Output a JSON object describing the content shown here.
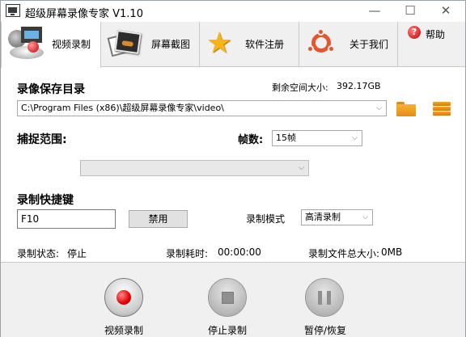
{
  "window": {
    "title": "超级屏幕录像专家 V1.10",
    "min_glyph": "—",
    "max_glyph": "☐",
    "close_glyph": "✕"
  },
  "tabs": [
    {
      "label": "视频录制",
      "icon": "video-record-icon",
      "active": true
    },
    {
      "label": "屏幕截图",
      "icon": "screenshot-icon",
      "active": false
    },
    {
      "label": "软件注册",
      "icon": "star-icon",
      "active": false
    },
    {
      "label": "关于我们",
      "icon": "ubuntu-ring-icon",
      "active": false
    },
    {
      "label": "帮助",
      "icon": "help-icon",
      "active": false
    }
  ],
  "help_icon_glyph": "?",
  "star_glyph": "★",
  "save": {
    "title": "录像保存目录",
    "free_space_label": "剩余空间大小:",
    "free_space_value": "392.17GB",
    "path": "C:\\Program Files (x86)\\超级屏幕录像专家\\video\\"
  },
  "capture": {
    "title": "捕捉范围:",
    "region_value": "",
    "fps_label": "帧数:",
    "fps_value": "15帧"
  },
  "hotkey": {
    "title": "录制快捷键",
    "value": "F10",
    "disable_label": "禁用",
    "mode_label": "录制模式",
    "mode_value": "高清录制"
  },
  "status": {
    "state_label": "录制状态:",
    "state_value": "停止",
    "elapsed_label": "录制耗时:",
    "elapsed_value": "00:00:00",
    "size_label": "录制文件总大小:",
    "size_value": "0MB"
  },
  "controls": {
    "record_label": "视频录制",
    "stop_label": "停止录制",
    "pause_label": "暂停/恢复"
  },
  "arrow_glyph": "⌵",
  "colors": {
    "accent_red": "#e00000",
    "folder_orange": "#f0a020",
    "star_yellow": "#f6b51a"
  }
}
